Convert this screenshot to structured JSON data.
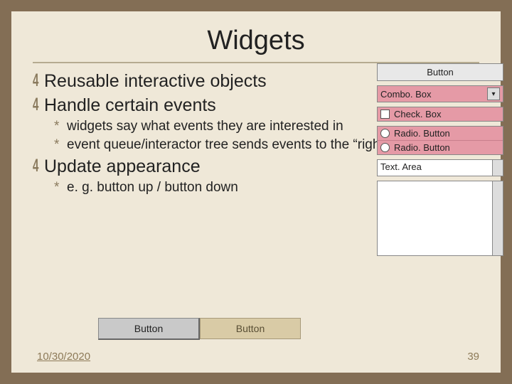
{
  "title": "Widgets",
  "points": {
    "p1": "Reusable interactive objects",
    "p2": "Handle certain events",
    "p2a": "widgets say what events they are interested in",
    "p2b": "event queue/interactor tree sends events to the “right” widget",
    "p3": "Update appearance",
    "p3a": "e. g. button up / button down"
  },
  "widgets": {
    "button": "Button",
    "combo": "Combo. Box",
    "check": "Check. Box",
    "radio": "Radio. Button",
    "textarea": "Text. Area"
  },
  "bottom": {
    "btn1": "Button",
    "btn2": "Button"
  },
  "footer": {
    "date": "10/30/2020",
    "page": "39"
  }
}
